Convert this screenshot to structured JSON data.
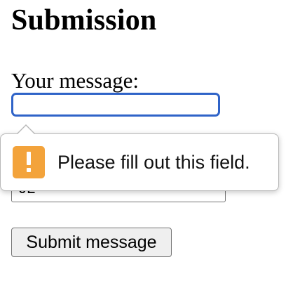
{
  "page": {
    "title": "Submission"
  },
  "form": {
    "message_label": "Your message:",
    "message_value": "",
    "hidden_field_partial_text": "JL",
    "submit_label": "Submit message"
  },
  "validation": {
    "message": "Please fill out this field.",
    "icon": "warning-icon",
    "icon_color": "#f3a33b"
  },
  "colors": {
    "focus_ring": "#2f63c8",
    "button_background": "#efefef"
  }
}
